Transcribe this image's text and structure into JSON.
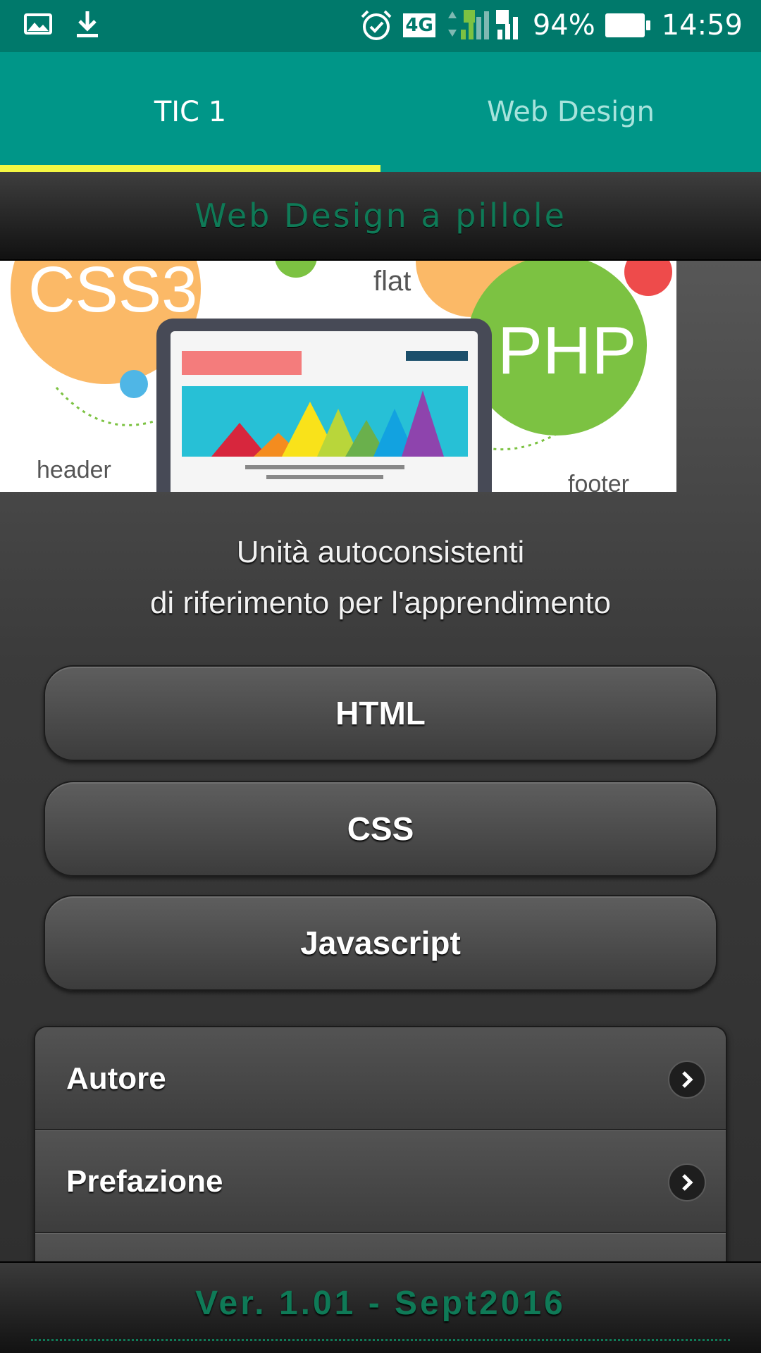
{
  "status_bar": {
    "battery": "94%",
    "time": "14:59",
    "network": "4G",
    "sim1": "1",
    "sim2": "2",
    "icons": [
      "image-icon",
      "download-icon",
      "alarm-icon",
      "signal-icon",
      "battery-icon"
    ]
  },
  "tabs": [
    {
      "label": "TIC 1",
      "active": true
    },
    {
      "label": "Web Design",
      "active": false
    }
  ],
  "header": {
    "title": "Web Design a pillole"
  },
  "banner": {
    "labels": {
      "css": "CSS3",
      "php": "PHP",
      "flat": "flat",
      "header": "header",
      "footer": "footer"
    }
  },
  "intro": {
    "line1": "Unità autoconsistenti",
    "line2": "di riferimento per l'apprendimento"
  },
  "buttons": [
    {
      "label": "HTML"
    },
    {
      "label": "CSS"
    },
    {
      "label": "Javascript"
    }
  ],
  "list": [
    {
      "label": "Autore",
      "icon": "chevron-right-icon"
    },
    {
      "label": "Prefazione",
      "icon": "chevron-right-icon"
    }
  ],
  "footer": {
    "version": "Ver. 1.01 - Sept2016"
  },
  "colors": {
    "status_bar": "#00796b",
    "tab_bar": "#009688",
    "tab_indicator": "#f4f742",
    "title_green": "#0f7a57"
  }
}
